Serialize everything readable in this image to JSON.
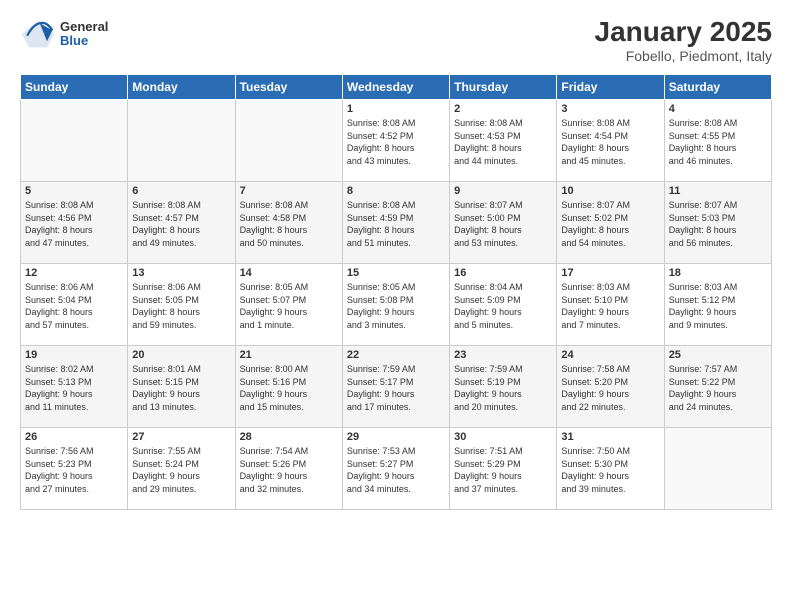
{
  "logo": {
    "general": "General",
    "blue": "Blue"
  },
  "title": "January 2025",
  "subtitle": "Fobello, Piedmont, Italy",
  "headers": [
    "Sunday",
    "Monday",
    "Tuesday",
    "Wednesday",
    "Thursday",
    "Friday",
    "Saturday"
  ],
  "weeks": [
    [
      {
        "day": "",
        "info": ""
      },
      {
        "day": "",
        "info": ""
      },
      {
        "day": "",
        "info": ""
      },
      {
        "day": "1",
        "info": "Sunrise: 8:08 AM\nSunset: 4:52 PM\nDaylight: 8 hours\nand 43 minutes."
      },
      {
        "day": "2",
        "info": "Sunrise: 8:08 AM\nSunset: 4:53 PM\nDaylight: 8 hours\nand 44 minutes."
      },
      {
        "day": "3",
        "info": "Sunrise: 8:08 AM\nSunset: 4:54 PM\nDaylight: 8 hours\nand 45 minutes."
      },
      {
        "day": "4",
        "info": "Sunrise: 8:08 AM\nSunset: 4:55 PM\nDaylight: 8 hours\nand 46 minutes."
      }
    ],
    [
      {
        "day": "5",
        "info": "Sunrise: 8:08 AM\nSunset: 4:56 PM\nDaylight: 8 hours\nand 47 minutes."
      },
      {
        "day": "6",
        "info": "Sunrise: 8:08 AM\nSunset: 4:57 PM\nDaylight: 8 hours\nand 49 minutes."
      },
      {
        "day": "7",
        "info": "Sunrise: 8:08 AM\nSunset: 4:58 PM\nDaylight: 8 hours\nand 50 minutes."
      },
      {
        "day": "8",
        "info": "Sunrise: 8:08 AM\nSunset: 4:59 PM\nDaylight: 8 hours\nand 51 minutes."
      },
      {
        "day": "9",
        "info": "Sunrise: 8:07 AM\nSunset: 5:00 PM\nDaylight: 8 hours\nand 53 minutes."
      },
      {
        "day": "10",
        "info": "Sunrise: 8:07 AM\nSunset: 5:02 PM\nDaylight: 8 hours\nand 54 minutes."
      },
      {
        "day": "11",
        "info": "Sunrise: 8:07 AM\nSunset: 5:03 PM\nDaylight: 8 hours\nand 56 minutes."
      }
    ],
    [
      {
        "day": "12",
        "info": "Sunrise: 8:06 AM\nSunset: 5:04 PM\nDaylight: 8 hours\nand 57 minutes."
      },
      {
        "day": "13",
        "info": "Sunrise: 8:06 AM\nSunset: 5:05 PM\nDaylight: 8 hours\nand 59 minutes."
      },
      {
        "day": "14",
        "info": "Sunrise: 8:05 AM\nSunset: 5:07 PM\nDaylight: 9 hours\nand 1 minute."
      },
      {
        "day": "15",
        "info": "Sunrise: 8:05 AM\nSunset: 5:08 PM\nDaylight: 9 hours\nand 3 minutes."
      },
      {
        "day": "16",
        "info": "Sunrise: 8:04 AM\nSunset: 5:09 PM\nDaylight: 9 hours\nand 5 minutes."
      },
      {
        "day": "17",
        "info": "Sunrise: 8:03 AM\nSunset: 5:10 PM\nDaylight: 9 hours\nand 7 minutes."
      },
      {
        "day": "18",
        "info": "Sunrise: 8:03 AM\nSunset: 5:12 PM\nDaylight: 9 hours\nand 9 minutes."
      }
    ],
    [
      {
        "day": "19",
        "info": "Sunrise: 8:02 AM\nSunset: 5:13 PM\nDaylight: 9 hours\nand 11 minutes."
      },
      {
        "day": "20",
        "info": "Sunrise: 8:01 AM\nSunset: 5:15 PM\nDaylight: 9 hours\nand 13 minutes."
      },
      {
        "day": "21",
        "info": "Sunrise: 8:00 AM\nSunset: 5:16 PM\nDaylight: 9 hours\nand 15 minutes."
      },
      {
        "day": "22",
        "info": "Sunrise: 7:59 AM\nSunset: 5:17 PM\nDaylight: 9 hours\nand 17 minutes."
      },
      {
        "day": "23",
        "info": "Sunrise: 7:59 AM\nSunset: 5:19 PM\nDaylight: 9 hours\nand 20 minutes."
      },
      {
        "day": "24",
        "info": "Sunrise: 7:58 AM\nSunset: 5:20 PM\nDaylight: 9 hours\nand 22 minutes."
      },
      {
        "day": "25",
        "info": "Sunrise: 7:57 AM\nSunset: 5:22 PM\nDaylight: 9 hours\nand 24 minutes."
      }
    ],
    [
      {
        "day": "26",
        "info": "Sunrise: 7:56 AM\nSunset: 5:23 PM\nDaylight: 9 hours\nand 27 minutes."
      },
      {
        "day": "27",
        "info": "Sunrise: 7:55 AM\nSunset: 5:24 PM\nDaylight: 9 hours\nand 29 minutes."
      },
      {
        "day": "28",
        "info": "Sunrise: 7:54 AM\nSunset: 5:26 PM\nDaylight: 9 hours\nand 32 minutes."
      },
      {
        "day": "29",
        "info": "Sunrise: 7:53 AM\nSunset: 5:27 PM\nDaylight: 9 hours\nand 34 minutes."
      },
      {
        "day": "30",
        "info": "Sunrise: 7:51 AM\nSunset: 5:29 PM\nDaylight: 9 hours\nand 37 minutes."
      },
      {
        "day": "31",
        "info": "Sunrise: 7:50 AM\nSunset: 5:30 PM\nDaylight: 9 hours\nand 39 minutes."
      },
      {
        "day": "",
        "info": ""
      }
    ]
  ]
}
